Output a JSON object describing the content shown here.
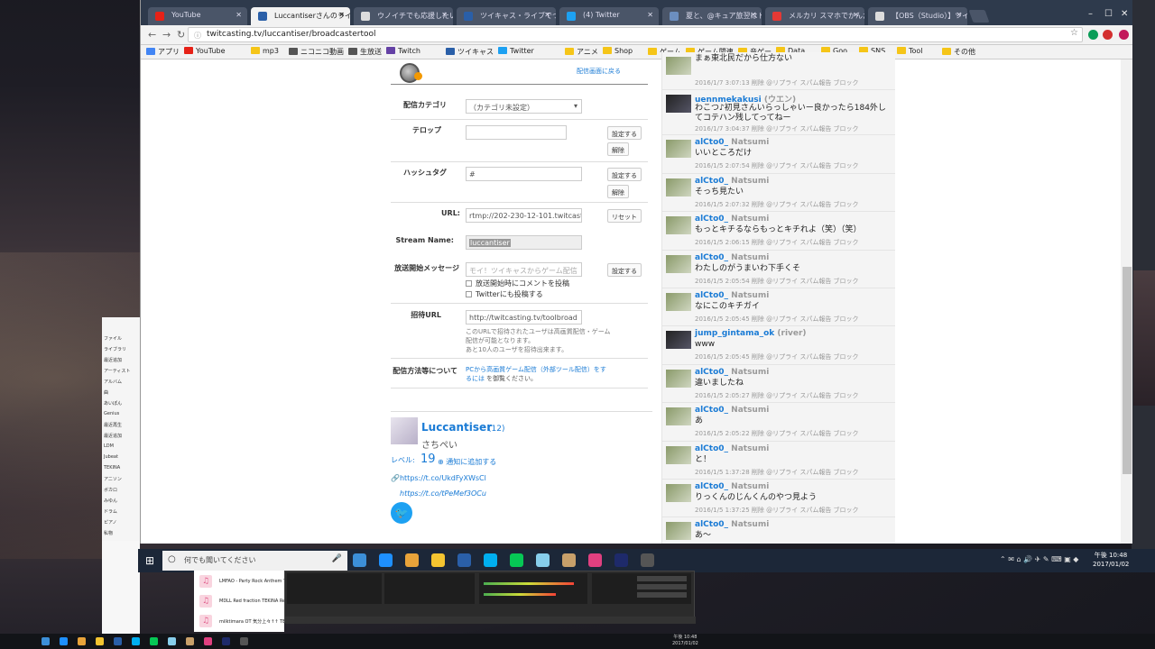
{
  "browser": {
    "tabs": [
      {
        "label": "YouTube",
        "color": "#e62117",
        "active": false
      },
      {
        "label": "Luccantiserさんのライブ配信",
        "color": "#2a5fa8",
        "active": true
      },
      {
        "label": "ウノイチでも応援したい！",
        "color": "#ddd",
        "active": false
      },
      {
        "label": "ツイキャス・ライブでつながる",
        "color": "#2a5fa8",
        "active": false
      },
      {
        "label": "(4) Twitter",
        "color": "#1da1f2",
        "active": false
      },
      {
        "label": "夏と、@キュア旅翌はトレス",
        "color": "#6c8ebf",
        "active": false
      },
      {
        "label": "メルカリ スマホでかんたん フ",
        "color": "#e53935",
        "active": false
      },
      {
        "label": "【OBS（Studio）】ツイキャ",
        "color": "#ddd",
        "active": false
      }
    ],
    "url": "twitcasting.tv/luccantiser/broadcastertool",
    "bookmarks": [
      {
        "label": "アプリ",
        "color": "#4285f4"
      },
      {
        "label": "YouTube",
        "color": "#e62117"
      },
      {
        "label": "mp3",
        "color": "#f5c518"
      },
      {
        "label": "ニコニコ動画",
        "color": "#555"
      },
      {
        "label": "生放送",
        "color": "#555"
      },
      {
        "label": "Twitch",
        "color": "#6441a5"
      },
      {
        "label": "ツイキャス",
        "color": "#2a5fa8"
      },
      {
        "label": "Twitter",
        "color": "#1da1f2"
      },
      {
        "label": "アニメ",
        "color": "#f5c518"
      },
      {
        "label": "Shop",
        "color": "#f5c518"
      },
      {
        "label": "ゲーム",
        "color": "#f5c518"
      },
      {
        "label": "ゲーム関連",
        "color": "#f5c518"
      },
      {
        "label": "音ゲー",
        "color": "#f5c518"
      },
      {
        "label": "Data",
        "color": "#f5c518"
      },
      {
        "label": "Goo",
        "color": "#f5c518"
      },
      {
        "label": "SNS",
        "color": "#f5c518"
      },
      {
        "label": "Tool",
        "color": "#f5c518"
      },
      {
        "label": "その他",
        "color": "#f5c518"
      }
    ]
  },
  "form": {
    "back_link": "配信画面に戻る",
    "category_label": "配信カテゴリ",
    "category_value": "（カテゴリ未設定）",
    "telop_label": "テロップ",
    "telop_value": "",
    "set_button": "設定する",
    "clear_button": "解除",
    "hashtag_label": "ハッシュタグ",
    "hashtag_value": "#",
    "url_label": "URL:",
    "url_value": "rtmp://202-230-12-101.twitcasting.tv",
    "reset_button": "リセット",
    "stream_name_label": "Stream Name:",
    "stream_name_value": "luccantiser",
    "start_msg_label": "放送開始メッセージ",
    "start_msg_placeholder": "モイ！ツイキャスからゲーム配信",
    "chk_comment": "放送開始時にコメントを投稿",
    "chk_twitter": "Twitterにも投稿する",
    "invite_label": "招待URL",
    "invite_value": "http://twitcasting.tv/toolbroad",
    "invite_note_1": "このURLで招待されたユーザは高画質配信・ゲーム",
    "invite_note_2": "配信が可能となります。",
    "invite_note_3": "あと10人のユーザを招待出来ます。",
    "method_label": "配信方法等について",
    "method_link_1": "PCから高画質ゲーム配信（外部ツール配信）をす",
    "method_link_2": "るには",
    "method_link_3": "を御覧ください。"
  },
  "profile": {
    "name": "Luccantiser",
    "count": "(12)",
    "subtitle": "さちぺい",
    "level_label": "レベル:",
    "level_value": "19",
    "follow_label": "通知に追加する",
    "link_1": "https://t.co/UkdFyXWsCl",
    "link_2": "https://t.co/tPeMef3OCu"
  },
  "comments": [
    {
      "name": "",
      "screen": "",
      "text": "まぁ東北民だから仕方ない",
      "meta": "2016/1/7 3:07:13 削除 @リプライ スパム報告 ブロック",
      "dark": false
    },
    {
      "name": "uennmekakusi",
      "screen": "(ウエン)",
      "text": "わこつ♪初見さんいらっしゃいー良かったら184外し",
      "text2": "てコテハン残してってねー",
      "meta": "2016/1/7 3:04:37 削除 @リプライ スパム報告 ブロック",
      "dark": true
    },
    {
      "name": "alCto0_",
      "screen": "Natsumi",
      "text": "いいところだけ",
      "meta": "2016/1/5 2:07:54 削除 @リプライ スパム報告 ブロック",
      "dark": false
    },
    {
      "name": "alCto0_",
      "screen": "Natsumi",
      "text": "そっち見たい",
      "meta": "2016/1/5 2:07:32 削除 @リプライ スパム報告 ブロック",
      "dark": false
    },
    {
      "name": "alCto0_",
      "screen": "Natsumi",
      "text": "もっとキチるならもっとキチれよ（笑）（笑）",
      "meta": "2016/1/5 2:06:15 削除 @リプライ スパム報告 ブロック",
      "dark": false
    },
    {
      "name": "alCto0_",
      "screen": "Natsumi",
      "text": "わたしのがうまいわ下手くそ",
      "meta": "2016/1/5 2:05:54 削除 @リプライ スパム報告 ブロック",
      "dark": false
    },
    {
      "name": "alCto0_",
      "screen": "Natsumi",
      "text": "なにこのキチガイ",
      "meta": "2016/1/5 2:05:45 削除 @リプライ スパム報告 ブロック",
      "dark": false
    },
    {
      "name": "jump_gintama_ok",
      "screen": "(river)",
      "text": "www",
      "meta": "2016/1/5 2:05:45 削除 @リプライ スパム報告 ブロック",
      "dark": true
    },
    {
      "name": "alCto0_",
      "screen": "Natsumi",
      "text": "違いましたね",
      "meta": "2016/1/5 2:05:27 削除 @リプライ スパム報告 ブロック",
      "dark": false
    },
    {
      "name": "alCto0_",
      "screen": "Natsumi",
      "text": "あ",
      "meta": "2016/1/5 2:05:22 削除 @リプライ スパム報告 ブロック",
      "dark": false
    },
    {
      "name": "alCto0_",
      "screen": "Natsumi",
      "text": "と！",
      "meta": "2016/1/5 1:37:28 削除 @リプライ スパム報告 ブロック",
      "dark": false
    },
    {
      "name": "alCto0_",
      "screen": "Natsumi",
      "text": "りっくんのじんくんのやつ見よう",
      "meta": "2016/1/5 1:37:25 削除 @リプライ スパム報告 ブロック",
      "dark": false
    },
    {
      "name": "alCto0_",
      "screen": "Natsumi",
      "text": "あ〜",
      "meta": "2016/1/5 1:36:31 削除 @リプライ スパム報告 ブロック",
      "dark": false
    }
  ],
  "taskbar": {
    "search_placeholder": "何でも聞いてください",
    "clock_time": "午後 10:48",
    "clock_date": "2017/01/02",
    "icons": [
      "#3c8fd8",
      "#1e90ff",
      "#e8a33a",
      "#f4c430",
      "#2a5fa8",
      "#00aff0",
      "#06c755",
      "#87ceeb",
      "#c8a06a",
      "#e04080",
      "#1e2a6a",
      "#555"
    ]
  },
  "playlist": [
    {
      "title": "LMFAO - Party Rock Anthem TEK"
    },
    {
      "title": "MDLL Red fraction TEKINA Remix"
    },
    {
      "title": "milktimara OT 気分上々↑↑ TEKIN"
    }
  ],
  "music_sidebar": [
    "ファイル",
    "ライブラリ",
    "最近追加",
    "アーティスト",
    "アルバム",
    "曲",
    "あいぽん",
    "Genius",
    "最近再生",
    "最近追加",
    "LDM",
    "Jubeat",
    "TEKINA",
    "アニソン",
    "ボカロ",
    "みゆん",
    "ドラム",
    "ピアノ",
    "私物",
    "その他"
  ]
}
